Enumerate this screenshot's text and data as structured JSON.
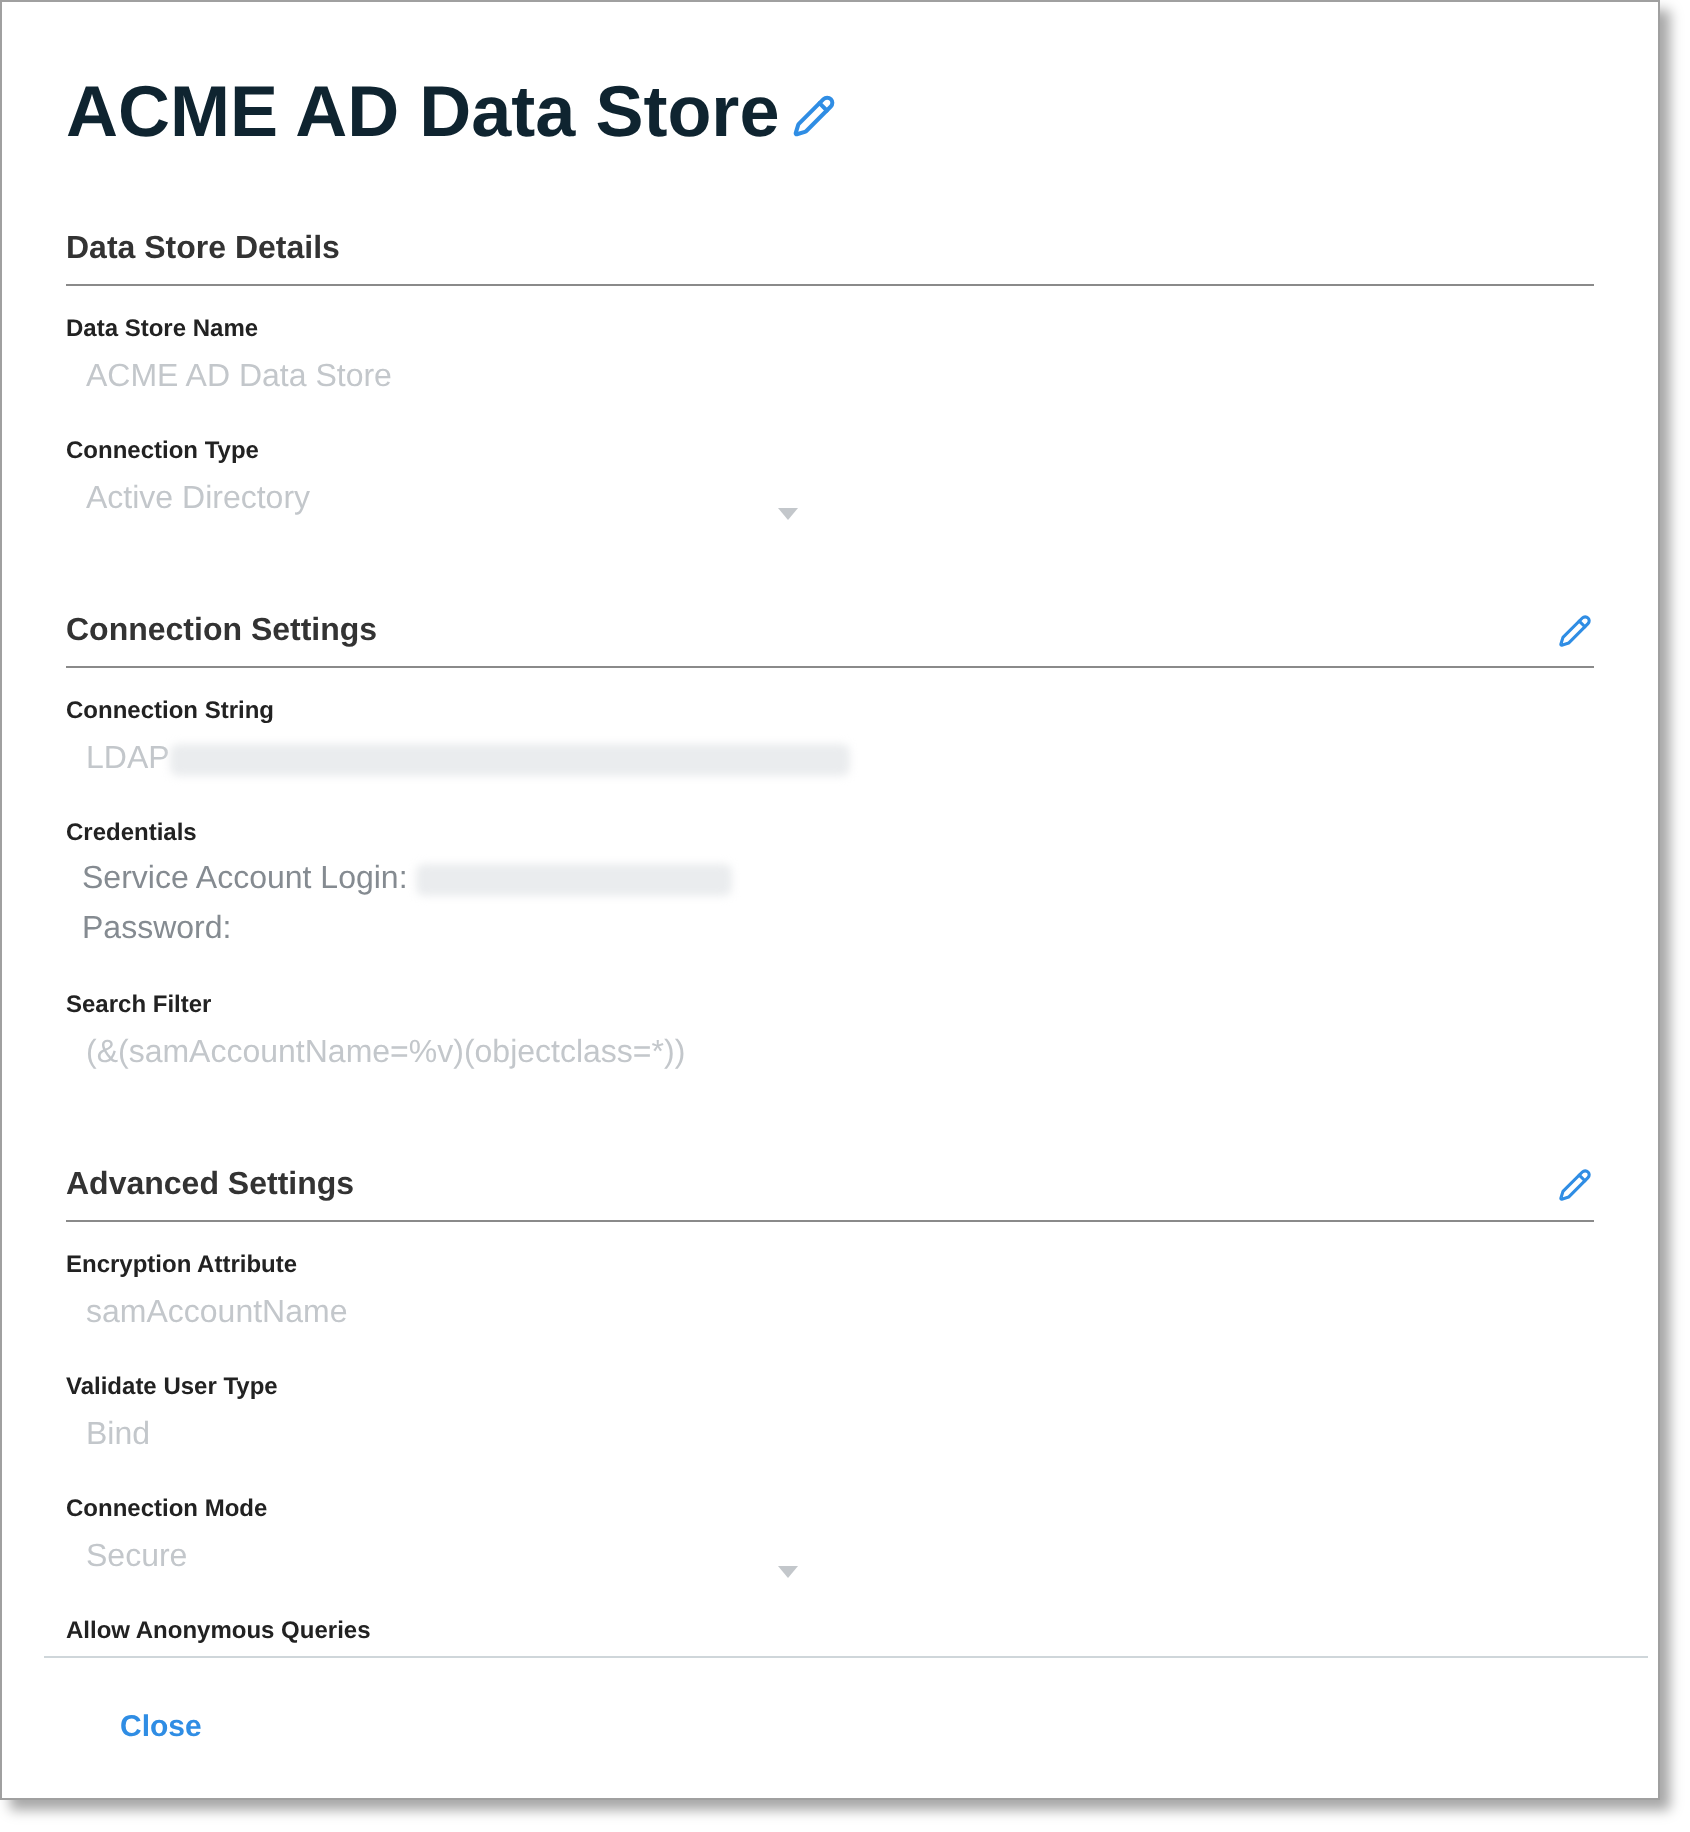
{
  "dialog": {
    "title": "ACME AD Data Store"
  },
  "sections": [
    {
      "heading": "Data Store Details",
      "editable": false,
      "fields": [
        {
          "kind": "text",
          "label": "Data Store Name",
          "value": "ACME AD Data Store",
          "disabled": true
        },
        {
          "kind": "select",
          "label": "Connection Type",
          "value": "Active Directory",
          "disabled": true
        }
      ]
    },
    {
      "heading": "Connection Settings",
      "editable": true,
      "fields": [
        {
          "kind": "text",
          "label": "Connection String",
          "value": "LDAP",
          "disabled": true,
          "redacted": true
        },
        {
          "kind": "credentials",
          "label": "Credentials",
          "lines": [
            {
              "label": "Service Account Login:",
              "redacted": true
            },
            {
              "label": "Password:",
              "redacted": false
            }
          ]
        },
        {
          "kind": "text",
          "label": "Search Filter",
          "value": "(&(samAccountName=%v)(objectclass=*))",
          "disabled": true
        }
      ]
    },
    {
      "heading": "Advanced Settings",
      "editable": true,
      "fields": [
        {
          "kind": "text",
          "label": "Encryption Attribute",
          "value": "samAccountName",
          "disabled": true
        },
        {
          "kind": "text",
          "label": "Validate User Type",
          "value": "Bind",
          "disabled": true
        },
        {
          "kind": "select",
          "label": "Connection Mode",
          "value": "Secure",
          "disabled": true
        },
        {
          "kind": "text",
          "label": "Allow Anonymous Queries"
        }
      ]
    }
  ],
  "footer": {
    "buttons": [
      "Close"
    ]
  }
}
